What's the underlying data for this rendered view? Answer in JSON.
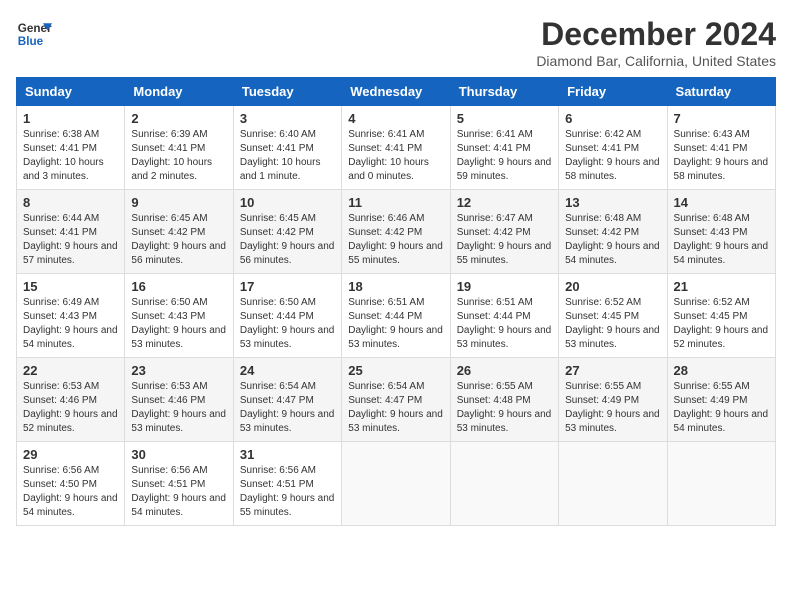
{
  "header": {
    "logo_line1": "General",
    "logo_line2": "Blue",
    "month_title": "December 2024",
    "location": "Diamond Bar, California, United States"
  },
  "weekdays": [
    "Sunday",
    "Monday",
    "Tuesday",
    "Wednesday",
    "Thursday",
    "Friday",
    "Saturday"
  ],
  "weeks": [
    [
      {
        "day": "1",
        "sunrise": "6:38 AM",
        "sunset": "4:41 PM",
        "daylight": "10 hours and 3 minutes."
      },
      {
        "day": "2",
        "sunrise": "6:39 AM",
        "sunset": "4:41 PM",
        "daylight": "10 hours and 2 minutes."
      },
      {
        "day": "3",
        "sunrise": "6:40 AM",
        "sunset": "4:41 PM",
        "daylight": "10 hours and 1 minute."
      },
      {
        "day": "4",
        "sunrise": "6:41 AM",
        "sunset": "4:41 PM",
        "daylight": "10 hours and 0 minutes."
      },
      {
        "day": "5",
        "sunrise": "6:41 AM",
        "sunset": "4:41 PM",
        "daylight": "9 hours and 59 minutes."
      },
      {
        "day": "6",
        "sunrise": "6:42 AM",
        "sunset": "4:41 PM",
        "daylight": "9 hours and 58 minutes."
      },
      {
        "day": "7",
        "sunrise": "6:43 AM",
        "sunset": "4:41 PM",
        "daylight": "9 hours and 58 minutes."
      }
    ],
    [
      {
        "day": "8",
        "sunrise": "6:44 AM",
        "sunset": "4:41 PM",
        "daylight": "9 hours and 57 minutes."
      },
      {
        "day": "9",
        "sunrise": "6:45 AM",
        "sunset": "4:42 PM",
        "daylight": "9 hours and 56 minutes."
      },
      {
        "day": "10",
        "sunrise": "6:45 AM",
        "sunset": "4:42 PM",
        "daylight": "9 hours and 56 minutes."
      },
      {
        "day": "11",
        "sunrise": "6:46 AM",
        "sunset": "4:42 PM",
        "daylight": "9 hours and 55 minutes."
      },
      {
        "day": "12",
        "sunrise": "6:47 AM",
        "sunset": "4:42 PM",
        "daylight": "9 hours and 55 minutes."
      },
      {
        "day": "13",
        "sunrise": "6:48 AM",
        "sunset": "4:42 PM",
        "daylight": "9 hours and 54 minutes."
      },
      {
        "day": "14",
        "sunrise": "6:48 AM",
        "sunset": "4:43 PM",
        "daylight": "9 hours and 54 minutes."
      }
    ],
    [
      {
        "day": "15",
        "sunrise": "6:49 AM",
        "sunset": "4:43 PM",
        "daylight": "9 hours and 54 minutes."
      },
      {
        "day": "16",
        "sunrise": "6:50 AM",
        "sunset": "4:43 PM",
        "daylight": "9 hours and 53 minutes."
      },
      {
        "day": "17",
        "sunrise": "6:50 AM",
        "sunset": "4:44 PM",
        "daylight": "9 hours and 53 minutes."
      },
      {
        "day": "18",
        "sunrise": "6:51 AM",
        "sunset": "4:44 PM",
        "daylight": "9 hours and 53 minutes."
      },
      {
        "day": "19",
        "sunrise": "6:51 AM",
        "sunset": "4:44 PM",
        "daylight": "9 hours and 53 minutes."
      },
      {
        "day": "20",
        "sunrise": "6:52 AM",
        "sunset": "4:45 PM",
        "daylight": "9 hours and 53 minutes."
      },
      {
        "day": "21",
        "sunrise": "6:52 AM",
        "sunset": "4:45 PM",
        "daylight": "9 hours and 52 minutes."
      }
    ],
    [
      {
        "day": "22",
        "sunrise": "6:53 AM",
        "sunset": "4:46 PM",
        "daylight": "9 hours and 52 minutes."
      },
      {
        "day": "23",
        "sunrise": "6:53 AM",
        "sunset": "4:46 PM",
        "daylight": "9 hours and 53 minutes."
      },
      {
        "day": "24",
        "sunrise": "6:54 AM",
        "sunset": "4:47 PM",
        "daylight": "9 hours and 53 minutes."
      },
      {
        "day": "25",
        "sunrise": "6:54 AM",
        "sunset": "4:47 PM",
        "daylight": "9 hours and 53 minutes."
      },
      {
        "day": "26",
        "sunrise": "6:55 AM",
        "sunset": "4:48 PM",
        "daylight": "9 hours and 53 minutes."
      },
      {
        "day": "27",
        "sunrise": "6:55 AM",
        "sunset": "4:49 PM",
        "daylight": "9 hours and 53 minutes."
      },
      {
        "day": "28",
        "sunrise": "6:55 AM",
        "sunset": "4:49 PM",
        "daylight": "9 hours and 54 minutes."
      }
    ],
    [
      {
        "day": "29",
        "sunrise": "6:56 AM",
        "sunset": "4:50 PM",
        "daylight": "9 hours and 54 minutes."
      },
      {
        "day": "30",
        "sunrise": "6:56 AM",
        "sunset": "4:51 PM",
        "daylight": "9 hours and 54 minutes."
      },
      {
        "day": "31",
        "sunrise": "6:56 AM",
        "sunset": "4:51 PM",
        "daylight": "9 hours and 55 minutes."
      },
      null,
      null,
      null,
      null
    ]
  ],
  "labels": {
    "sunrise": "Sunrise:",
    "sunset": "Sunset:",
    "daylight": "Daylight:"
  }
}
